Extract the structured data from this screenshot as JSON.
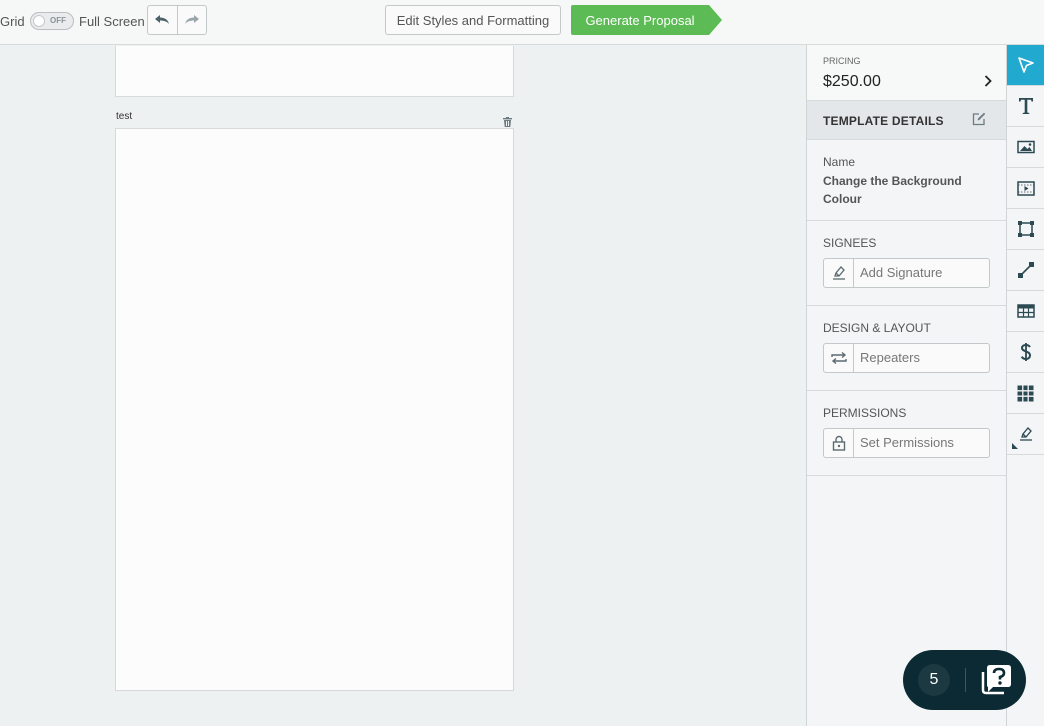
{
  "toolbar": {
    "grid_label": "Grid",
    "toggle_state": "OFF",
    "fullscreen_label": "Full Screen",
    "edit_styles_label": "Edit Styles and Formatting",
    "generate_label": "Generate Proposal",
    "generate_color": "#5dbb56"
  },
  "canvas": {
    "block_label": "test"
  },
  "panel": {
    "pricing_label": "PRICING",
    "pricing_value": "$250.00",
    "template_details_title": "TEMPLATE DETAILS",
    "name_label": "Name",
    "name_value": "Change the Background Colour",
    "signees_heading": "SIGNEES",
    "add_signature_label": "Add Signature",
    "design_heading": "DESIGN & LAYOUT",
    "repeaters_label": "Repeaters",
    "permissions_heading": "PERMISSIONS",
    "set_permissions_label": "Set Permissions"
  },
  "rail": {
    "accent_color": "#22a9cf",
    "tools": [
      "select-pointer-icon",
      "text-icon",
      "image-icon",
      "video-icon",
      "shape-icon",
      "line-icon",
      "table-icon",
      "pricing-dollar-icon",
      "grid-block-icon",
      "signature-icon"
    ]
  },
  "chat": {
    "count": "5"
  }
}
